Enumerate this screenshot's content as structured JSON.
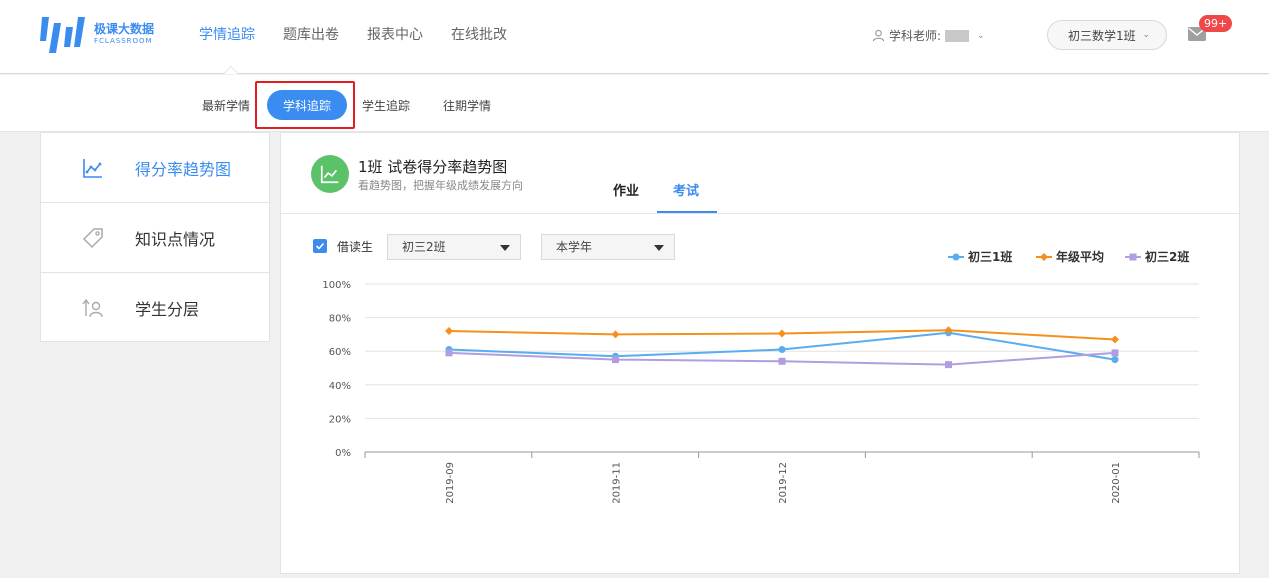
{
  "brand": {
    "name_cn": "极课大数据",
    "name_en": "FCLASSROOM",
    "color": "#3b8cf0"
  },
  "nav": {
    "items": [
      {
        "label": "学情追踪",
        "active": true
      },
      {
        "label": "题库出卷",
        "active": false
      },
      {
        "label": "报表中心",
        "active": false
      },
      {
        "label": "在线批改",
        "active": false
      }
    ]
  },
  "user": {
    "role_label": "学科老师:"
  },
  "class_select": {
    "value": "初三数学1班"
  },
  "messages": {
    "badge": "99+"
  },
  "subnav": {
    "items": [
      {
        "label": "最新学情",
        "active": false
      },
      {
        "label": "学科追踪",
        "active": true
      },
      {
        "label": "学生追踪",
        "active": false
      },
      {
        "label": "往期学情",
        "active": false
      }
    ]
  },
  "leftmenu": {
    "items": [
      {
        "label": "得分率趋势图",
        "icon": "trend-chart-icon",
        "active": true
      },
      {
        "label": "知识点情况",
        "icon": "tag-icon",
        "active": false
      },
      {
        "label": "学生分层",
        "icon": "student-layer-icon",
        "active": false
      }
    ]
  },
  "panel": {
    "title": "1班 试卷得分率趋势图",
    "subtitle": "看趋势图，把握年级成绩发展方向",
    "tabs": [
      {
        "label": "作业",
        "active": false
      },
      {
        "label": "考试",
        "active": true
      }
    ]
  },
  "filters": {
    "checkbox_label": "借读生",
    "checkbox_checked": true,
    "compare_class": "初三2班",
    "period": "本学年"
  },
  "chart_data": {
    "type": "line",
    "categories": [
      "2019-09",
      "2019-11",
      "2019-12",
      "",
      "2020-01"
    ],
    "x_tick_labels": [
      "2019-09",
      "2019-11",
      "2019-12",
      "2020-01"
    ],
    "ylim": [
      0,
      100
    ],
    "y_ticks": [
      "0%",
      "20%",
      "40%",
      "60%",
      "80%",
      "100%"
    ],
    "grid": true,
    "legend_position": "top-right",
    "series": [
      {
        "name": "初三1班",
        "color": "#5aacf0",
        "marker": "circle",
        "values": [
          61,
          57,
          61,
          71,
          55
        ]
      },
      {
        "name": "年级平均",
        "color": "#f5901e",
        "marker": "diamond",
        "values": [
          72,
          70,
          70.5,
          72.5,
          67
        ]
      },
      {
        "name": "初三2班",
        "color": "#b09ee0",
        "marker": "square",
        "values": [
          59,
          55,
          54,
          52,
          59
        ]
      }
    ]
  }
}
